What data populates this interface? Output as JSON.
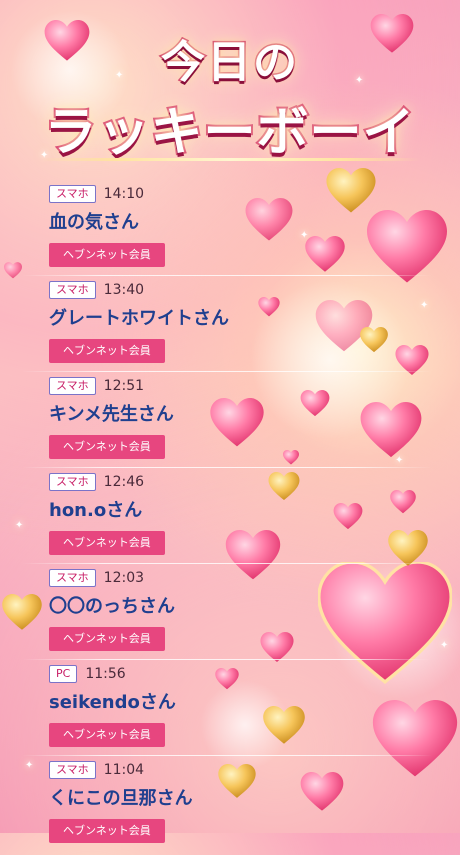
{
  "title": {
    "line1": "今日の",
    "line2": "ラッキーボーイ"
  },
  "entries": [
    {
      "device": "スマホ",
      "time": "14:10",
      "name": "血の気さん",
      "badge": "ヘブンネット会員"
    },
    {
      "device": "スマホ",
      "time": "13:40",
      "name": "グレートホワイトさん",
      "badge": "ヘブンネット会員"
    },
    {
      "device": "スマホ",
      "time": "12:51",
      "name": "キンメ先生さん",
      "badge": "ヘブンネット会員"
    },
    {
      "device": "スマホ",
      "time": "12:46",
      "name": "hon.oさん",
      "badge": "ヘブンネット会員"
    },
    {
      "device": "スマホ",
      "time": "12:03",
      "name": "〇〇のっちさん",
      "badge": "ヘブンネット会員"
    },
    {
      "device": "PC",
      "time": "11:56",
      "name": "seikendoさん",
      "badge": "ヘブンネット会員"
    },
    {
      "device": "スマホ",
      "time": "11:04",
      "name": "くにこの旦那さん",
      "badge": "ヘブンネット会員"
    }
  ],
  "colors": {
    "device_text": "#c81e66",
    "device_border": "#7b73c8",
    "name_text": "#1f3f8f",
    "member_badge_bg": "#e7467f",
    "title_stroke": "#d42a67"
  }
}
